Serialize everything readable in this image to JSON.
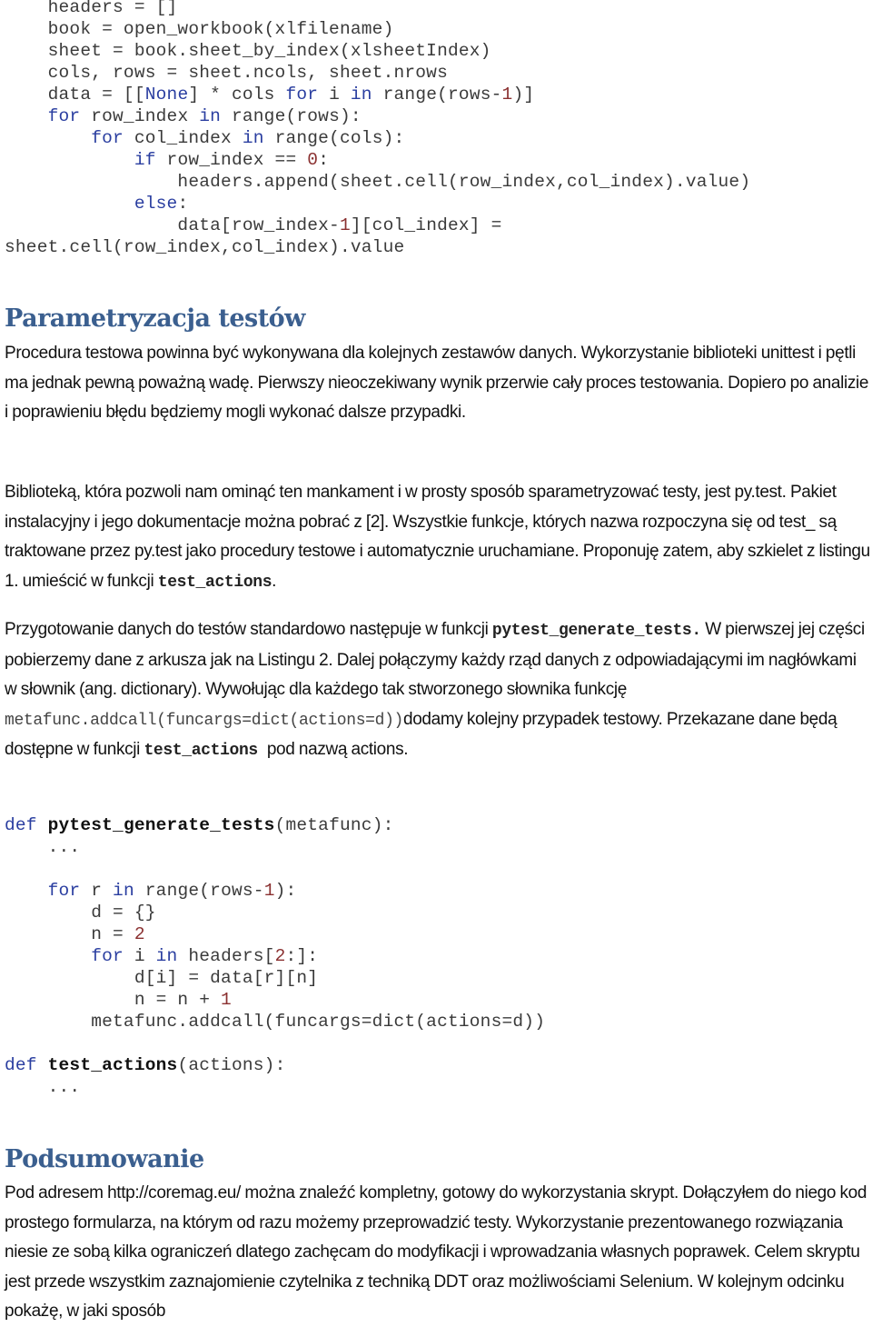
{
  "code_listing_1": [
    [
      {
        "t": "    headers = []"
      }
    ],
    [
      {
        "t": "    book = open_workbook(xlfilename)"
      }
    ],
    [
      {
        "t": "    sheet = book.sheet_by_index(xlsheetIndex)"
      }
    ],
    [
      {
        "t": "    cols, rows = sheet.ncols, sheet.nrows"
      }
    ],
    [
      {
        "t": "    data = [["
      },
      {
        "t": "None",
        "c": "kw"
      },
      {
        "t": "] * cols "
      },
      {
        "t": "for",
        "c": "kw"
      },
      {
        "t": " i "
      },
      {
        "t": "in",
        "c": "kw"
      },
      {
        "t": " range(rows-"
      },
      {
        "t": "1",
        "c": "num"
      },
      {
        "t": ")]"
      }
    ],
    [
      {
        "t": "    "
      },
      {
        "t": "for",
        "c": "kw"
      },
      {
        "t": " row_index "
      },
      {
        "t": "in",
        "c": "kw"
      },
      {
        "t": " range(rows):"
      }
    ],
    [
      {
        "t": "        "
      },
      {
        "t": "for",
        "c": "kw"
      },
      {
        "t": " col_index "
      },
      {
        "t": "in",
        "c": "kw"
      },
      {
        "t": " range(cols):"
      }
    ],
    [
      {
        "t": "            "
      },
      {
        "t": "if",
        "c": "kw"
      },
      {
        "t": " row_index == "
      },
      {
        "t": "0",
        "c": "num"
      },
      {
        "t": ":"
      }
    ],
    [
      {
        "t": "                headers.append(sheet.cell(row_index,col_index).value)"
      }
    ],
    [
      {
        "t": "            "
      },
      {
        "t": "else",
        "c": "kw"
      },
      {
        "t": ":"
      }
    ],
    [
      {
        "t": "                data[row_index-"
      },
      {
        "t": "1",
        "c": "num"
      },
      {
        "t": "][col_index] ="
      }
    ],
    [
      {
        "t": "sheet.cell(row_index,col_index).value"
      }
    ]
  ],
  "section_parametrization": {
    "heading": "Parametryzacja testów",
    "paragraph_1": "Procedura testowa powinna być wykonywana dla kolejnych zestawów danych. Wykorzystanie biblioteki unittest i pętli ma jednak pewną poważną wadę. Pierwszy nieoczekiwany wynik przerwie cały proces testowania. Dopiero po analizie i poprawieniu błędu będziemy mogli wykonać dalsze przypadki.",
    "paragraph_2_text": "Biblioteką, która pozwoli nam ominąć ten mankament i w prosty sposób sparametryzować testy, jest py.test. Pakiet instalacyjny i jego dokumentacje można pobrać z [2]. Wszystkie funkcje, których nazwa rozpoczyna się od test_ są traktowane przez py.test jako procedury testowe i automatycznie uruchamiane. Proponuję zatem, aby szkielet z listingu 1. umieścić w funkcji ",
    "paragraph_2_code": "test_actions",
    "paragraph_2_end": ".",
    "paragraph_3_a": "Przygotowanie danych do testów standardowo następuje w funkcji ",
    "paragraph_3_code_1": "pytest_generate_tests.",
    "paragraph_3_b": " W pierwszej jej części pobierzemy dane z arkusza jak na Listingu 2. Dalej połączymy każdy rząd danych z odpowiadającymi im nagłówkami w słownik (ang. dictionary).  Wywołując dla każdego tak stworzonego słownika funkcję ",
    "paragraph_3_code_2": "metafunc.addcall(funcargs=dict(actions=d))",
    "paragraph_3_c": "dodamy kolejny przypadek testowy. Przekazane dane będą dostępne w funkcji ",
    "paragraph_3_code_3": "test_actions ",
    "paragraph_3_d": " pod nazwą actions."
  },
  "code_listing_2": [
    [
      {
        "t": "def",
        "c": "kw"
      },
      {
        "t": " "
      },
      {
        "t": "pytest_generate_tests",
        "c": "fn"
      },
      {
        "t": "(metafunc):"
      }
    ],
    [
      {
        "t": "    ..."
      }
    ],
    [
      {
        "t": ""
      }
    ],
    [
      {
        "t": "    "
      },
      {
        "t": "for",
        "c": "kw"
      },
      {
        "t": " r "
      },
      {
        "t": "in",
        "c": "kw"
      },
      {
        "t": " range(rows-"
      },
      {
        "t": "1",
        "c": "num"
      },
      {
        "t": "):"
      }
    ],
    [
      {
        "t": "        d = {}"
      }
    ],
    [
      {
        "t": "        n = "
      },
      {
        "t": "2",
        "c": "num"
      }
    ],
    [
      {
        "t": "        "
      },
      {
        "t": "for",
        "c": "kw"
      },
      {
        "t": " i "
      },
      {
        "t": "in",
        "c": "kw"
      },
      {
        "t": " headers["
      },
      {
        "t": "2",
        "c": "num"
      },
      {
        "t": ":]:"
      }
    ],
    [
      {
        "t": "            d[i] = data[r][n]"
      }
    ],
    [
      {
        "t": "            n = n + "
      },
      {
        "t": "1",
        "c": "num"
      }
    ],
    [
      {
        "t": "        metafunc.addcall(funcargs=dict(actions=d))"
      }
    ],
    [
      {
        "t": ""
      }
    ],
    [
      {
        "t": "def",
        "c": "kw"
      },
      {
        "t": " "
      },
      {
        "t": "test_actions",
        "c": "fn"
      },
      {
        "t": "(actions):"
      }
    ],
    [
      {
        "t": "    ..."
      }
    ]
  ],
  "section_summary": {
    "heading": "Podsumowanie",
    "paragraph": "Pod adresem http://coremag.eu/ można znaleźć kompletny, gotowy do wykorzystania skrypt. Dołączyłem do niego kod prostego formularza, na którym od razu możemy przeprowadzić testy. Wykorzystanie prezentowanego rozwiązania niesie ze sobą kilka ograniczeń dlatego zachęcam do modyfikacji i wprowadzania własnych poprawek. Celem skryptu jest przede wszystkim zaznajomienie czytelnika z techniką DDT oraz możliwościami Selenium. W kolejnym odcinku pokażę, w jaki sposób"
  },
  "colors": {
    "heading": "#3b5f8f",
    "code_keyword": "#2a3ea0",
    "code_number": "#8a3030",
    "code_text": "#3a3a3a",
    "body_text": "#111111"
  }
}
